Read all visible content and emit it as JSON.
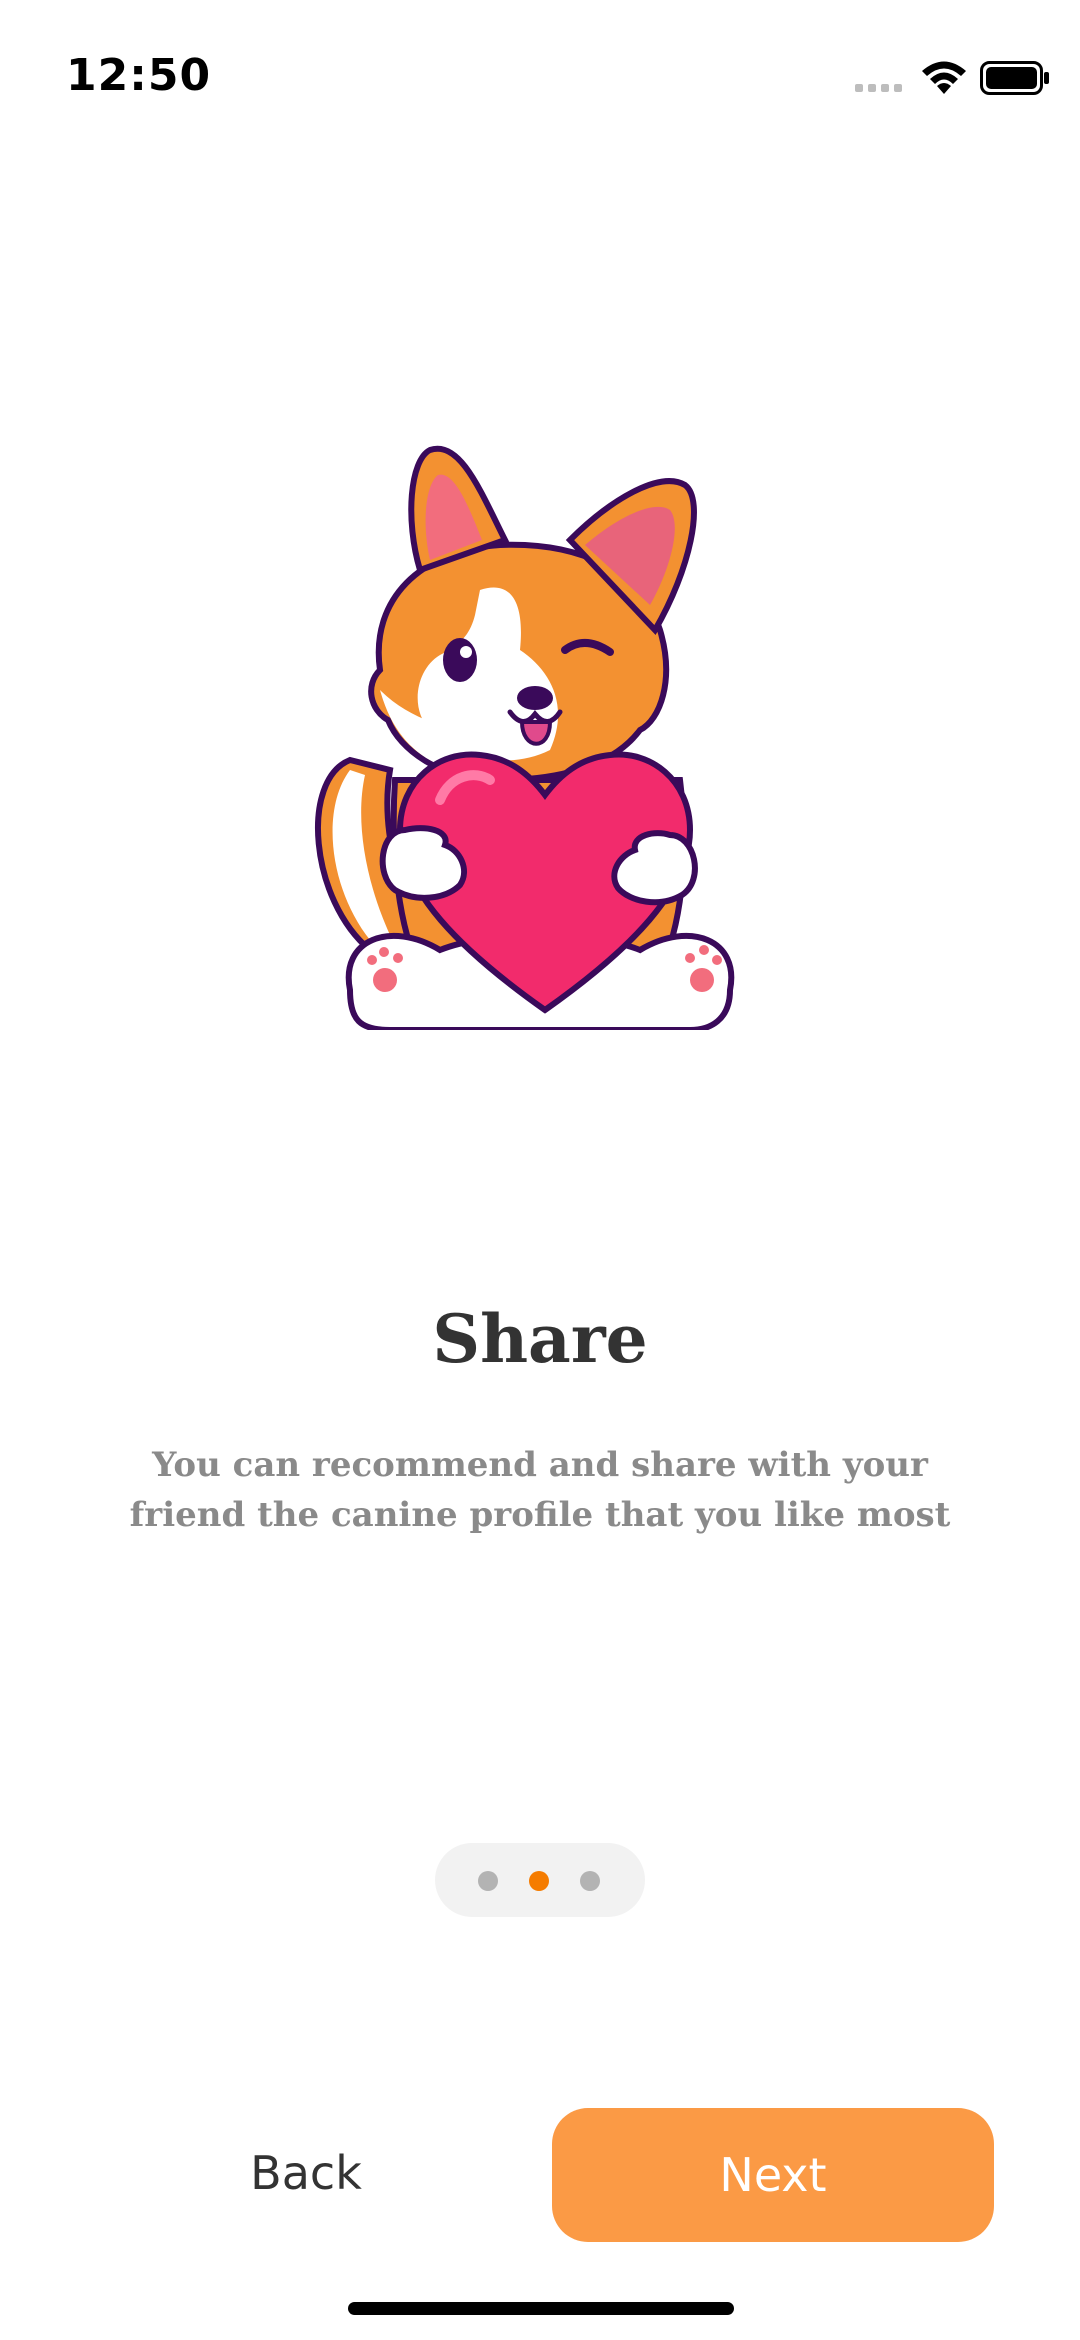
{
  "status_bar": {
    "time": "12:50",
    "icons": [
      "cellular-signal-icon",
      "wifi-icon",
      "battery-icon"
    ]
  },
  "illustration": {
    "subject": "corgi-holding-heart-illustration"
  },
  "onboarding": {
    "title": "Share",
    "subtitle_line1": "You can recommend and share with your",
    "subtitle_line2": "friend the canine profile that you like most"
  },
  "pager": {
    "page_count": 3,
    "active_index": 2,
    "active_color": "#f57c00",
    "inactive_color": "#b3b3b3"
  },
  "buttons": {
    "back_label": "Back",
    "next_label": "Next",
    "next_color": "#fb9a45"
  }
}
